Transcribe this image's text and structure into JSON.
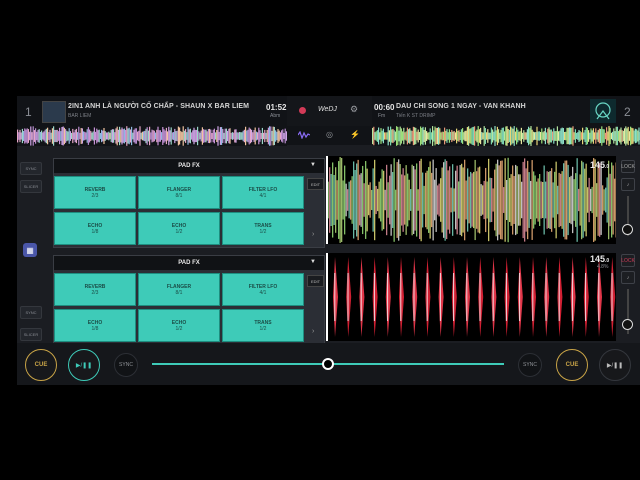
{
  "deck_left": {
    "number": "1",
    "title": "2IN1 ANH LÀ NGƯỜI CỐ CHẤP - SHAUN X BAR LIEM",
    "artist": "BAR LIEM",
    "time": "01:52",
    "remain_label": "Abm"
  },
  "deck_right": {
    "number": "2",
    "title": "DAU CHI SONG 1 NGAY - VAN KHANH",
    "artist": "Tiến K ST DRIMP",
    "time": "00:60",
    "remain_label": "Fm"
  },
  "center": {
    "logo": "WeDJ",
    "wave_icon": "waveform-icon",
    "gear": "⚙",
    "eq": "◎",
    "fx": "⚡"
  },
  "side_buttons": {
    "sync_top": "SYNC",
    "slicer_top": "SLICER",
    "sync_bottom": "SYNC",
    "slicer_bottom": "SLICER"
  },
  "pad_panel_top": {
    "header": "PAD FX",
    "edit": "EDIT",
    "pads": [
      {
        "name": "REVERB",
        "value": "2/3"
      },
      {
        "name": "FLANGER",
        "value": "8/1"
      },
      {
        "name": "FILTER LFO",
        "value": "4/1"
      },
      {
        "name": "ECHO",
        "value": "1/8"
      },
      {
        "name": "ECHO",
        "value": "1/2"
      },
      {
        "name": "TRANS",
        "value": "1/2"
      }
    ]
  },
  "pad_panel_bottom": {
    "header": "PAD FX",
    "edit": "EDIT",
    "pads": [
      {
        "name": "REVERB",
        "value": "2/3"
      },
      {
        "name": "FLANGER",
        "value": "8/1"
      },
      {
        "name": "FILTER LFO",
        "value": "4/1"
      },
      {
        "name": "ECHO",
        "value": "1/8"
      },
      {
        "name": "ECHO",
        "value": "1/2"
      },
      {
        "name": "TRANS",
        "value": "1/2"
      }
    ]
  },
  "bpm_top": {
    "value": "145",
    "decimal": ".0"
  },
  "bpm_bottom": {
    "value": "145",
    "decimal": ".0",
    "pitch": "4.8%"
  },
  "right_controls": {
    "lock_top": "LOCK",
    "lock_bottom": "LOCK"
  },
  "bottom": {
    "cue_left": "CUE",
    "play_left": "▶/❚❚",
    "sync_left": "SYNC",
    "sync_right": "SYNC",
    "cue_right": "CUE",
    "play_right": "▶/❚❚",
    "crossfader_position": 0.5
  },
  "colors": {
    "accent": "#3ecbb8",
    "cue": "#c9a447",
    "pad": "#3ecbb8",
    "record": "#d23a57"
  }
}
